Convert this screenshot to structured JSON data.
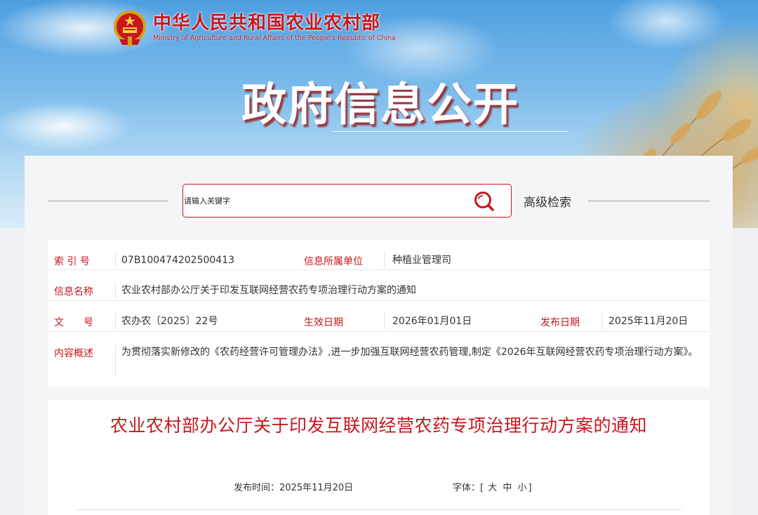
{
  "brand": {
    "name_cn": "中华人民共和国农业农村部",
    "name_en": "Ministry of Agriculture and Rural Affairs of the People's Republic of China",
    "emblem_icon": "national-emblem-icon",
    "primary_color": "#c8161e"
  },
  "hero": {
    "title": "政府信息公开"
  },
  "search": {
    "placeholder": "请输入关键字",
    "value": "",
    "icon": "search-icon",
    "advanced_label": "高级检索"
  },
  "info": {
    "index_label": "索 引 号",
    "index_value": "07B100474202500413",
    "unit_label": "信息所属单位",
    "unit_value": "种植业管理司",
    "name_label": "信息名称",
    "name_value": "农业农村部办公厅关于印发互联网经营农药专项治理行动方案的通知",
    "doc_label": "文　　号",
    "doc_value": "农办农〔2025〕22号",
    "effective_label": "生效日期",
    "effective_value": "2026年01月01日",
    "publish_label": "发布日期",
    "publish_value": "2025年11月20日",
    "summary_label": "内容概述",
    "summary_value": "为贯彻落实新修改的《农药经营许可管理办法》,进一步加强互联网经营农药管理,制定《2026年互联网经营农药专项治理行动方案》。"
  },
  "article": {
    "title": "农业农村部办公厅关于印发互联网经营农药专项治理行动方案的通知",
    "publish_time_label": "发布时间：",
    "publish_time": "2025年11月20日",
    "font_label": "字体：",
    "bracket_open": "[",
    "font_large": "大",
    "font_medium": "中",
    "font_small": "小",
    "bracket_close": "]"
  }
}
